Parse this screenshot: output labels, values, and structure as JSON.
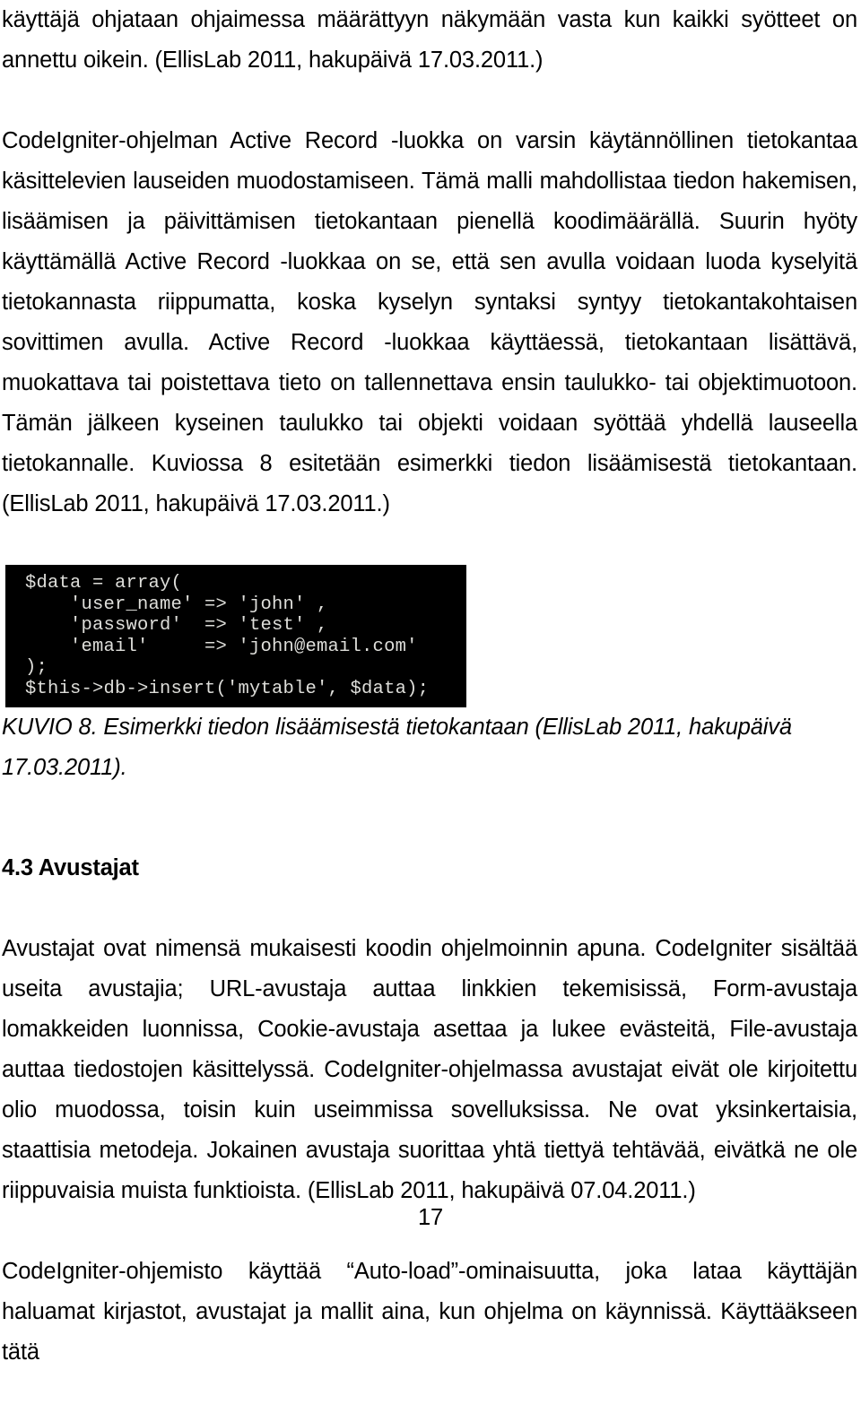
{
  "document": {
    "page_number": "17",
    "language": "fi"
  },
  "paragraphs": {
    "intro_continued": "käyttäjä ohjataan ohjaimessa määrättyyn näkymään vasta kun kaikki syötteet on annettu oikein. (EllisLab 2011, hakupäivä 17.03.2011.)",
    "active_record": "CodeIgniter-ohjelman Active Record -luokka on varsin käytännöllinen tietokantaa käsittelevien lauseiden muodostamiseen. Tämä malli mahdollistaa tiedon hakemisen, lisäämisen ja päivittämisen tietokantaan pienellä koodimäärällä. Suurin hyöty käyttämällä Active Record -luokkaa on se, että sen avulla voidaan luoda kyselyitä tietokannasta riippumatta, koska kyselyn syntaksi syntyy tietokantakohtaisen sovittimen avulla. Active Record -luokkaa käyttäessä, tietokantaan lisättävä, muokattava tai poistettava tieto on tallennettava ensin taulukko- tai objektimuotoon. Tämän jälkeen kyseinen taulukko tai objekti voidaan syöttää yhdellä lauseella tietokannalle. Kuviossa 8 esitetään esimerkki tiedon lisäämisestä tietokantaan. (EllisLab 2011, hakupäivä 17.03.2011.)",
    "avustajat_1": "Avustajat ovat nimensä mukaisesti koodin ohjelmoinnin apuna. CodeIgniter sisältää useita avustajia; URL-avustaja auttaa linkkien tekemisissä, Form-avustaja lomakkeiden luonnissa, Cookie-avustaja asettaa ja lukee evästeitä, File-avustaja auttaa tiedostojen käsittelyssä. CodeIgniter-ohjelmassa avustajat eivät ole kirjoitettu olio muodossa, toisin kuin useimmissa sovelluksissa. Ne ovat yksinkertaisia, staattisia metodeja. Jokainen avustaja suorittaa yhtä tiettyä tehtävää, eivätkä ne ole riippuvaisia muista funktioista. (EllisLab 2011, hakupäivä 07.04.2011.)",
    "autoload": "CodeIgniter-ohjemisto käyttää “Auto-load”-ominaisuutta, joka lataa käyttäjän haluamat kirjastot, avustajat ja mallit aina, kun ohjelma on käynnissä.  Käyttääkseen tätä"
  },
  "code_figure": {
    "code": "$data = array(\n    'user_name' => 'john' ,\n    'password'  => 'test' ,\n    'email'     => 'john@email.com'\n);\n$this->db->insert('mytable', $data);",
    "background_color": "#000000",
    "text_color": "#dededa",
    "caption_main": "KUVIO 8. Esimerkki tiedon lisäämisestä tietokantaan (EllisLab 2011, hakupäivä",
    "caption_last_line": "17.03.2011)."
  },
  "headings": {
    "section_4_3": "4.3 Avustajat"
  }
}
